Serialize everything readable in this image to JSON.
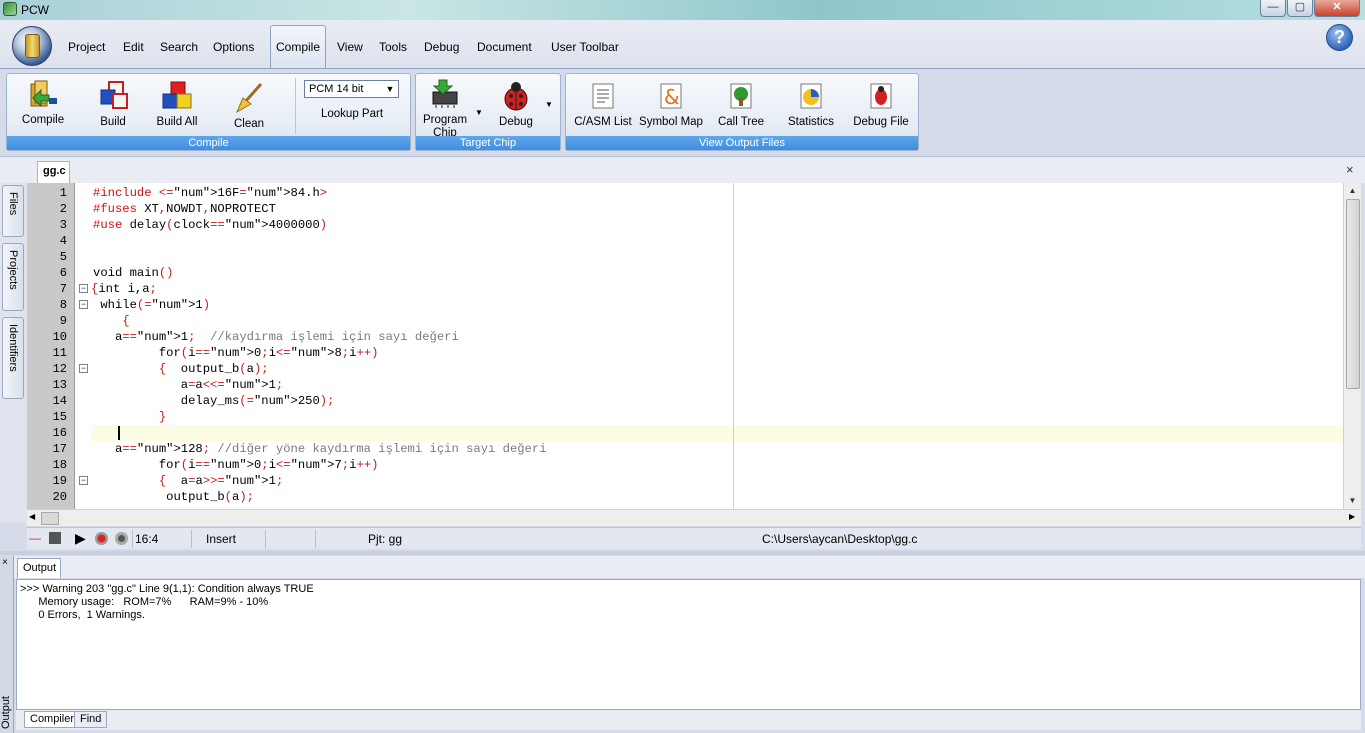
{
  "window": {
    "title": "PCW",
    "min": "—",
    "max": "▢",
    "close": "✕"
  },
  "menu": {
    "items": [
      "Project",
      "Edit",
      "Search",
      "Options",
      "Compile",
      "View",
      "Tools",
      "Debug",
      "Document",
      "User Toolbar"
    ],
    "active": "Compile",
    "help": "?"
  },
  "ribbon": {
    "compile_group": {
      "label": "Compile",
      "buttons": [
        "Compile",
        "Build",
        "Build All",
        "Clean"
      ]
    },
    "chip": {
      "selected": "PCM 14 bit",
      "lookup_label": "Lookup Part"
    },
    "target_group": {
      "label": "Target Chip",
      "program_line1": "Program",
      "program_line2": "Chip",
      "debug": "Debug"
    },
    "output_group": {
      "label": "View Output Files",
      "buttons": [
        "C/ASM List",
        "Symbol Map",
        "Call Tree",
        "Statistics",
        "Debug File"
      ]
    }
  },
  "editor": {
    "tab": "gg.c",
    "close": "×",
    "side_tabs": [
      "Files",
      "Projects",
      "Identifiers"
    ],
    "line_numbers": [
      "1",
      "2",
      "3",
      "4",
      "5",
      "6",
      "7",
      "8",
      "9",
      "10",
      "11",
      "12",
      "13",
      "14",
      "15",
      "16",
      "17",
      "18",
      "19",
      "20"
    ],
    "lines": [
      "#include <16F84.h>",
      "#fuses XT,NOWDT,NOPROTECT",
      "#use delay(clock=4000000)",
      "",
      "",
      "void main()",
      "{int i,a;",
      " while(1)",
      "    {",
      "   a=1;  //kaydırma işlemi için sayı değeri",
      "         for(i=0;i<8;i++)",
      "         {  output_b(a);",
      "            a=a<<1;",
      "            delay_ms(250);",
      "         }",
      "",
      "   a=128; //diğer yöne kaydırma işlemi için sayı değeri",
      "         for(i=0;i<7;i++)",
      "         {  a=a>>1;",
      "          output_b(a);"
    ]
  },
  "status": {
    "position": "16:4",
    "mode": "Insert",
    "project": "Pjt: gg",
    "path": "C:\\Users\\aycan\\Desktop\\gg.c"
  },
  "output": {
    "tab": "Output",
    "side_close": "×",
    "side_label": "Output",
    "lines": [
      ">>> Warning 203 \"gg.c\" Line 9(1,1): Condition always TRUE",
      "      Memory usage:   ROM=7%      RAM=9% - 10%",
      "      0 Errors,  1 Warnings."
    ],
    "bottom_tabs": [
      "Compiler",
      "Find"
    ]
  }
}
